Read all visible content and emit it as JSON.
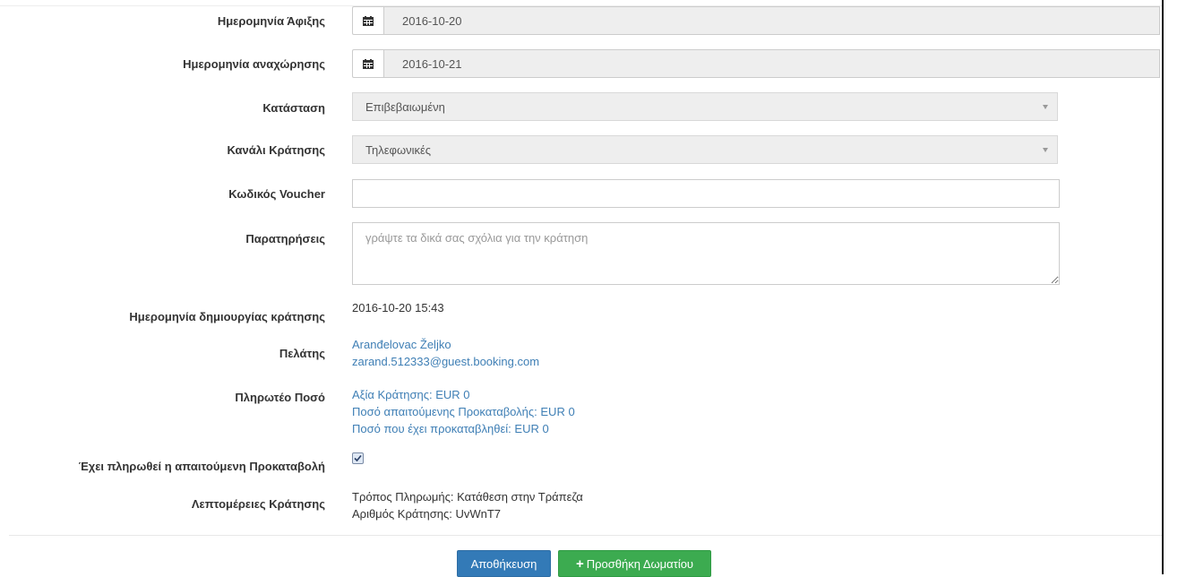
{
  "form": {
    "arrival": {
      "label": "Ημερομηνία Άφιξης",
      "value": "2016-10-20"
    },
    "departure": {
      "label": "Ημερομηνία αναχώρησης",
      "value": "2016-10-21"
    },
    "status": {
      "label": "Κατάσταση",
      "value": "Επιβεβαιωμένη"
    },
    "channel": {
      "label": "Κανάλι Κράτησης",
      "value": "Τηλεφωνικές"
    },
    "voucher": {
      "label": "Κωδικός Voucher",
      "value": ""
    },
    "notes": {
      "label": "Παρατηρήσεις",
      "placeholder": "γράψτε τα δικά σας σχόλια για την κράτηση"
    },
    "created": {
      "label": "Ημερομηνία δημιουργίας κράτησης",
      "value": "2016-10-20 15:43"
    },
    "customer": {
      "label": "Πελάτης",
      "name": "Aranđelovac Željko",
      "email": "zarand.512333@guest.booking.com"
    },
    "payable": {
      "label": "Πληρωτέο Ποσό",
      "lines": [
        "Αξία Κράτησης: EUR 0",
        "Ποσό απαιτούμενης Προκαταβολής: EUR 0",
        "Ποσό που έχει προκαταβληθεί: EUR 0"
      ]
    },
    "deposit_paid": {
      "label": "Έχει πληρωθεί η απαιτούμενη Προκαταβολή",
      "checked": true
    },
    "details": {
      "label": "Λεπτομέρειες Κράτησης",
      "lines": [
        "Τρόπος Πληρωμής: Κατάθεση στην Τράπεζα",
        "Αριθμός Κράτησης: UvWnT7"
      ]
    }
  },
  "buttons": {
    "save": "Αποθήκευση",
    "add_room": "Προσθήκη Δωματίου"
  },
  "icons": {
    "calendar": "calendar-icon",
    "plus": "plus-icon",
    "checkmark": "checkmark-icon"
  },
  "colors": {
    "primary": "#337ab7",
    "success": "#3cab50",
    "link": "#3f7fb5"
  }
}
